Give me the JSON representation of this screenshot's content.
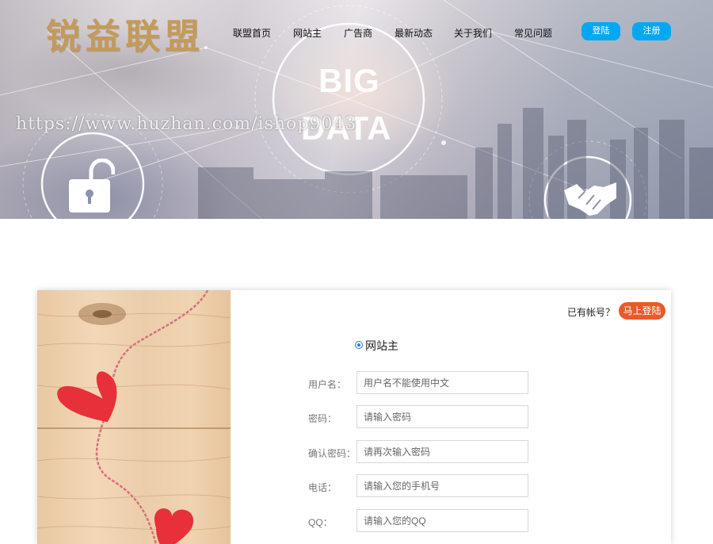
{
  "header": {
    "logo": "锐益联盟",
    "nav": [
      "联盟首页",
      "网站主",
      "广告商",
      "最新动态",
      "关于我们",
      "常见问题"
    ],
    "login_button": "登陆",
    "register_button": "注册"
  },
  "hero": {
    "big_text_1": "BIG",
    "big_text_2": "DATA",
    "watermark": "https://www.huzhan.com/ishop9043"
  },
  "form": {
    "has_account_text": "已有帐号？",
    "login_now_button": "马上登陆",
    "role_option": "网站主",
    "fields": [
      {
        "label": "用户名：",
        "placeholder": "用户名不能使用中文"
      },
      {
        "label": "密码：",
        "placeholder": "请输入密码"
      },
      {
        "label": "确认密码：",
        "placeholder": "请再次输入密码"
      },
      {
        "label": "电话：",
        "placeholder": "请输入您的手机号"
      },
      {
        "label": "QQ：",
        "placeholder": "请输入您的QQ"
      }
    ]
  },
  "colors": {
    "logo_gold": "#c49a5a",
    "nav_button_blue": "#00a9ef",
    "login_now_orange": "#e85a2a",
    "heart_red": "#e8303a"
  }
}
